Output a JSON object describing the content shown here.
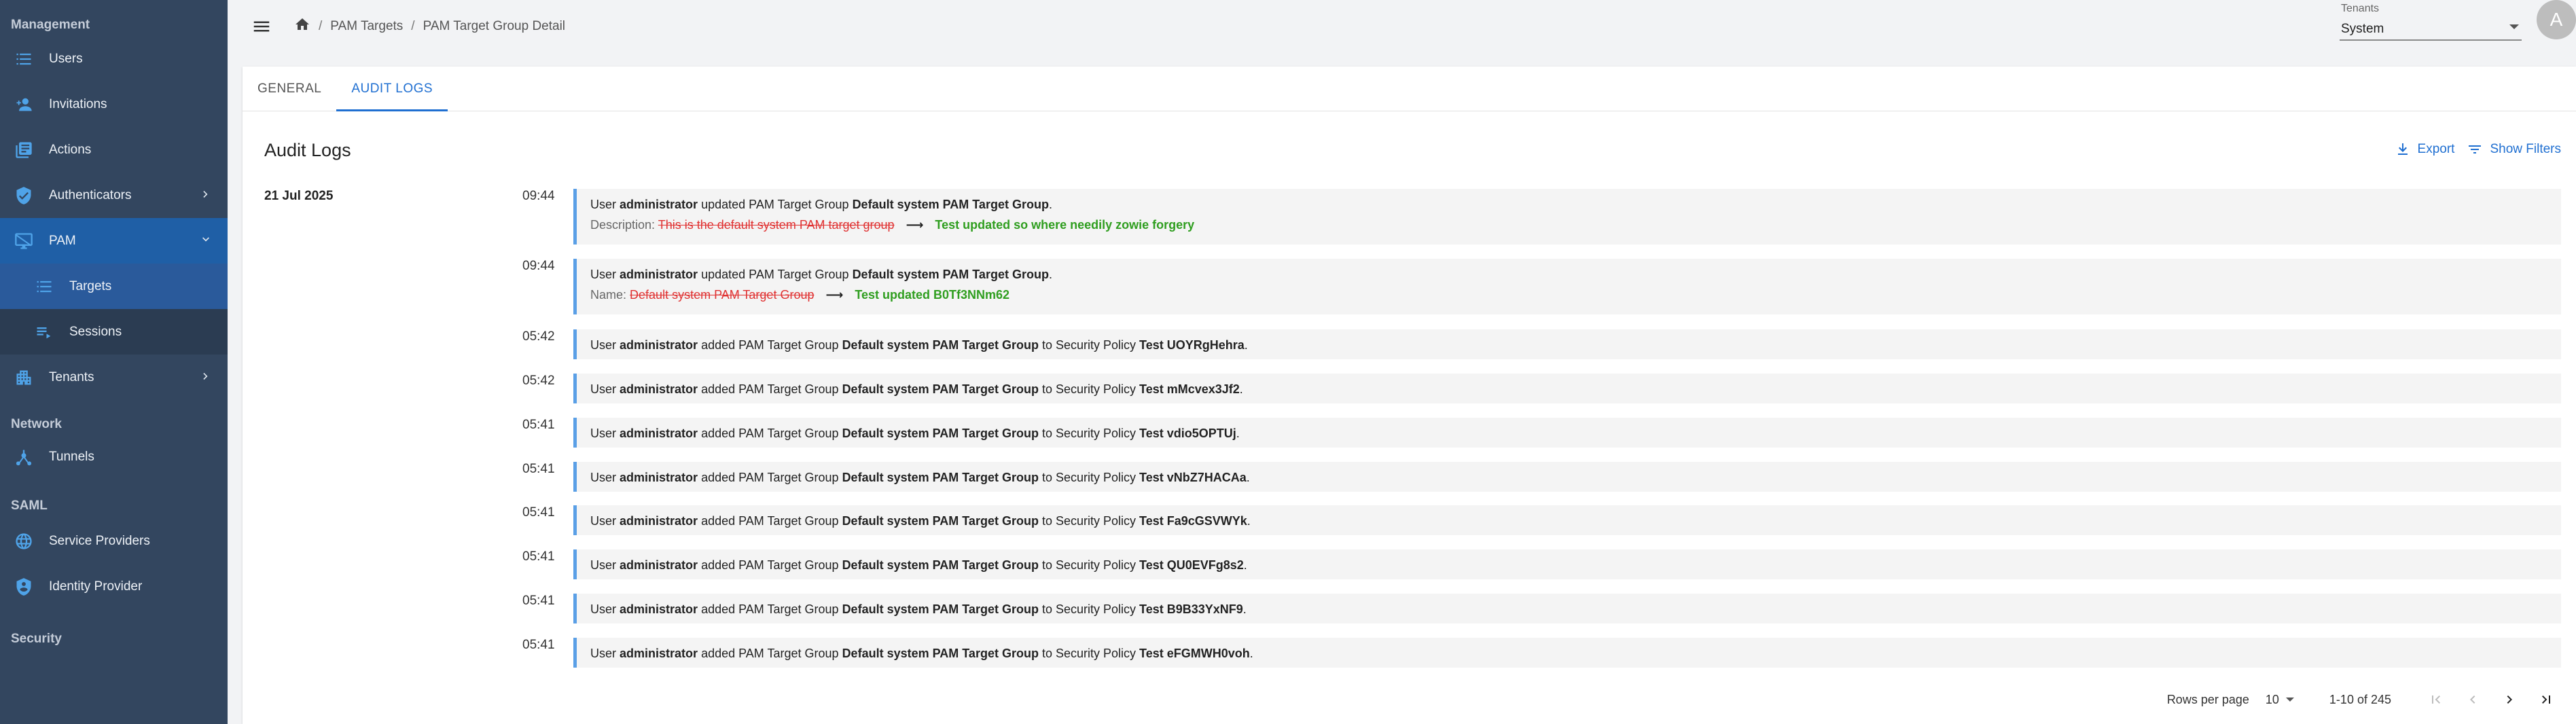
{
  "sidebar": {
    "sections": {
      "management": "Management",
      "network": "Network",
      "saml": "SAML",
      "security": "Security"
    },
    "items": {
      "users": "Users",
      "invitations": "Invitations",
      "actions": "Actions",
      "authenticators": "Authenticators",
      "pam": "PAM",
      "targets": "Targets",
      "sessions": "Sessions",
      "tenants": "Tenants",
      "tunnels": "Tunnels",
      "service_providers": "Service Providers",
      "identity_provider": "Identity Provider"
    }
  },
  "breadcrumb": {
    "level1": "PAM Targets",
    "level2": "PAM Target Group Detail"
  },
  "tenant": {
    "label": "Tenants",
    "value": "System"
  },
  "avatar": "A",
  "tabs": {
    "general": "GENERAL",
    "audit_logs": "AUDIT LOGS"
  },
  "section_title": "Audit Logs",
  "actions": {
    "export": "Export",
    "show_filters": "Show Filters"
  },
  "date": "21 Jul 2025",
  "logs": [
    {
      "time": "09:44",
      "user": "administrator",
      "group": "Default system PAM Target Group",
      "field": "Description:",
      "old": "This is the default system PAM target group",
      "new": "Test updated so where needily zowie forgery"
    },
    {
      "time": "09:44",
      "user": "administrator",
      "group": "Default system PAM Target Group",
      "field": "Name:",
      "old": "Default system PAM Target Group",
      "new": "Test updated B0Tf3NNm62"
    },
    {
      "time": "05:42",
      "user": "administrator",
      "group": "Default system PAM Target Group",
      "policy": "Test UOYRgHehra"
    },
    {
      "time": "05:42",
      "user": "administrator",
      "group": "Default system PAM Target Group",
      "policy": "Test mMcvex3Jf2"
    },
    {
      "time": "05:41",
      "user": "administrator",
      "group": "Default system PAM Target Group",
      "policy": "Test vdio5OPTUj"
    },
    {
      "time": "05:41",
      "user": "administrator",
      "group": "Default system PAM Target Group",
      "policy": "Test vNbZ7HACAa"
    },
    {
      "time": "05:41",
      "user": "administrator",
      "group": "Default system PAM Target Group",
      "policy": "Test Fa9cGSVWYk"
    },
    {
      "time": "05:41",
      "user": "administrator",
      "group": "Default system PAM Target Group",
      "policy": "Test QU0EVFg8s2"
    },
    {
      "time": "05:41",
      "user": "administrator",
      "group": "Default system PAM Target Group",
      "policy": "Test B9B33YxNF9"
    },
    {
      "time": "05:41",
      "user": "administrator",
      "group": "Default system PAM Target Group",
      "policy": "Test eFGMWH0voh"
    }
  ],
  "text": {
    "user": "User",
    "updated": "updated PAM Target Group",
    "added": "added PAM Target Group",
    "to_policy": "to Security Policy",
    "period": ".",
    "arrow": "⟶"
  },
  "pager": {
    "rows_per_page_label": "Rows per page",
    "rows_per_page": "10",
    "range": "1-10 of 245"
  },
  "colors": {
    "sidebar_bg": "#33465f",
    "sidebar_active": "#1f5fa6",
    "accent": "#1f6fd1",
    "log_border": "#5a9fe6",
    "removed": "#e03131",
    "added": "#2f9e1f"
  }
}
